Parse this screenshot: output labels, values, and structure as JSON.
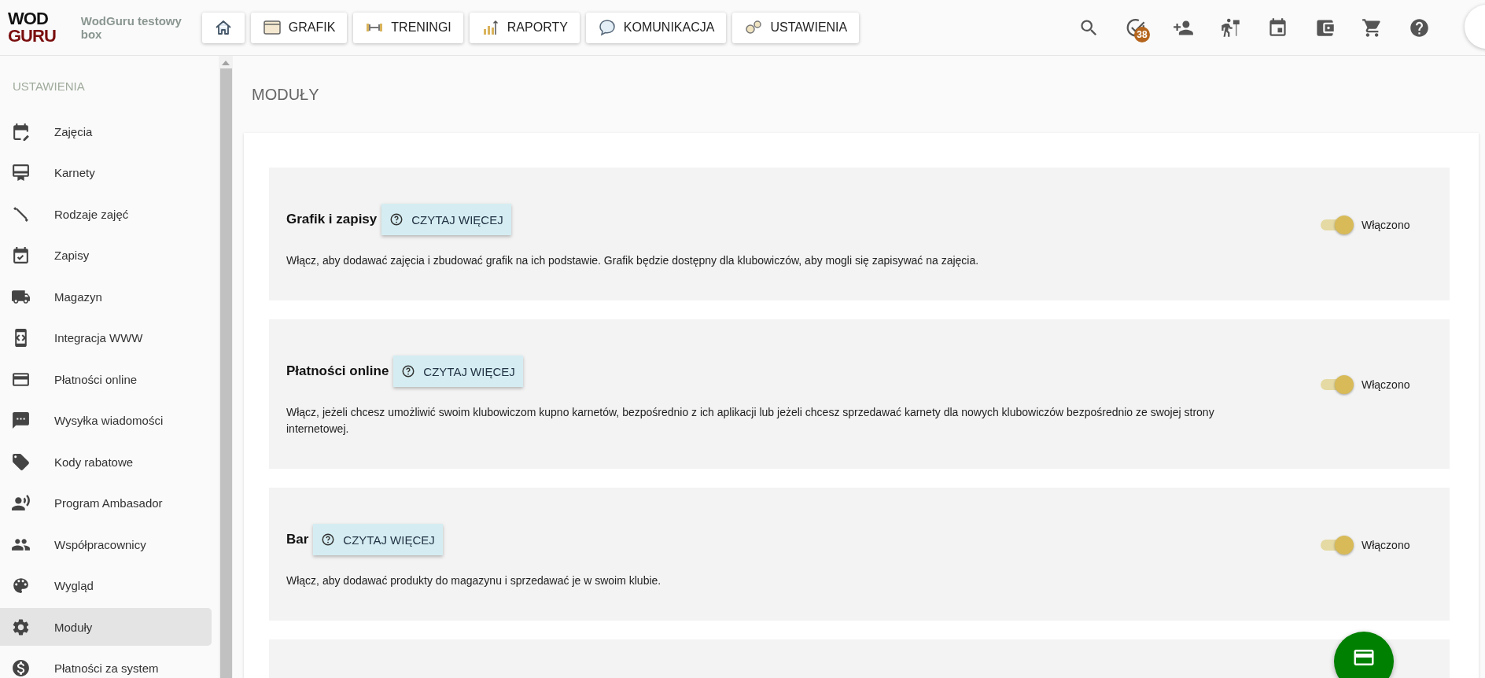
{
  "brand": {
    "logo_top": "WOD",
    "logo_bottom": "GURU",
    "name": "WodGuru testowy box"
  },
  "nav": [
    {
      "label": "GRAFIK"
    },
    {
      "label": "TRENINGI"
    },
    {
      "label": "RAPORTY"
    },
    {
      "label": "KOMUNIKACJA"
    },
    {
      "label": "USTAWIENIA"
    }
  ],
  "tasks_badge": "38",
  "sidebar": {
    "title": "USTAWIENIA",
    "items": [
      {
        "label": "Zajęcia",
        "selected": false
      },
      {
        "label": "Karnety",
        "selected": false
      },
      {
        "label": "Rodzaje zajęć",
        "selected": false
      },
      {
        "label": "Zapisy",
        "selected": false
      },
      {
        "label": "Magazyn",
        "selected": false
      },
      {
        "label": "Integracja WWW",
        "selected": false
      },
      {
        "label": "Płatności online",
        "selected": false
      },
      {
        "label": "Wysyłka wiadomości",
        "selected": false
      },
      {
        "label": "Kody rabatowe",
        "selected": false
      },
      {
        "label": "Program Ambasador",
        "selected": false
      },
      {
        "label": "Współpracownicy",
        "selected": false
      },
      {
        "label": "Wygląd",
        "selected": false
      },
      {
        "label": "Moduły",
        "selected": true
      },
      {
        "label": "Płatności za system",
        "selected": false
      }
    ]
  },
  "page_title": "MODUŁY",
  "modules": [
    {
      "title": "Grafik i zapisy",
      "read_more": "CZYTAJ WIĘCEJ",
      "description": "Włącz, aby dodawać zajęcia i zbudować grafik na ich podstawie. Grafik będzie dostępny dla klubowiczów, aby mogli się zapisywać na zajęcia.",
      "on": true,
      "status": "Włączono"
    },
    {
      "title": "Płatności online",
      "read_more": "CZYTAJ WIĘCEJ",
      "description": "Włącz, jeżeli chcesz umożliwić swoim klubowiczom kupno karnetów, bezpośrednio z ich aplikacji lub jeżeli chcesz sprzedawać karnety dla nowych klubowiczów bezpośrednio ze swojej strony internetowej.",
      "on": true,
      "status": "Włączono"
    },
    {
      "title": "Bar",
      "read_more": "CZYTAJ WIĘCEJ",
      "description": "Włącz, aby dodawać produkty do magazynu i sprzedawać je w swoim klubie.",
      "on": true,
      "status": "Włączono"
    }
  ]
}
